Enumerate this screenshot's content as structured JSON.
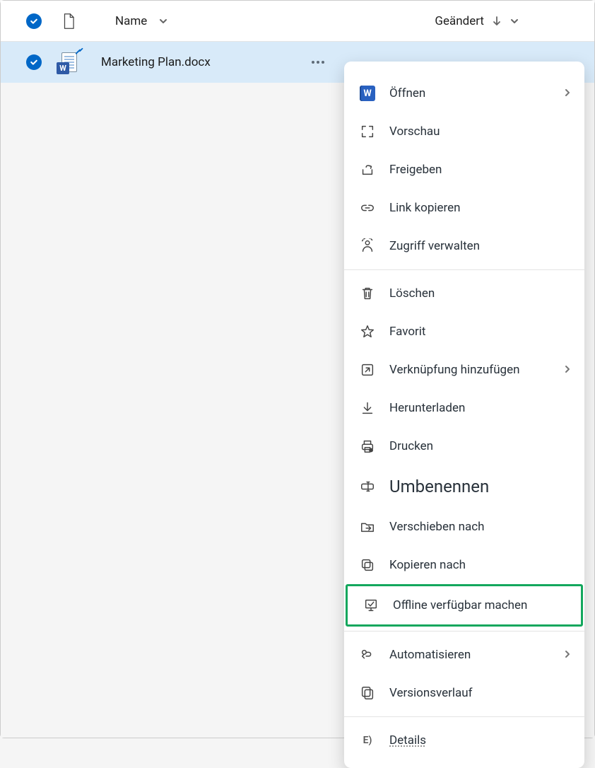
{
  "header": {
    "name_label": "Name",
    "modified_label": "Geändert"
  },
  "file_row": {
    "filename": "Marketing Plan.docx"
  },
  "menu": {
    "open": "Öffnen",
    "preview": "Vorschau",
    "share": "Freigeben",
    "copy_link": "Link kopieren",
    "manage_access": "Zugriff verwalten",
    "delete": "Löschen",
    "favorite": "Favorit",
    "add_shortcut": "Verknüpfung hinzufügen",
    "download": "Herunterladen",
    "print": "Drucken",
    "rename": "Umbenennen",
    "move_to": "Verschieben nach",
    "copy_to": "Kopieren nach",
    "make_offline": "Offline verfügbar machen",
    "automate": "Automatisieren",
    "version_history": "Versionsverlauf",
    "details_prefix": "E)",
    "details": "Details"
  }
}
